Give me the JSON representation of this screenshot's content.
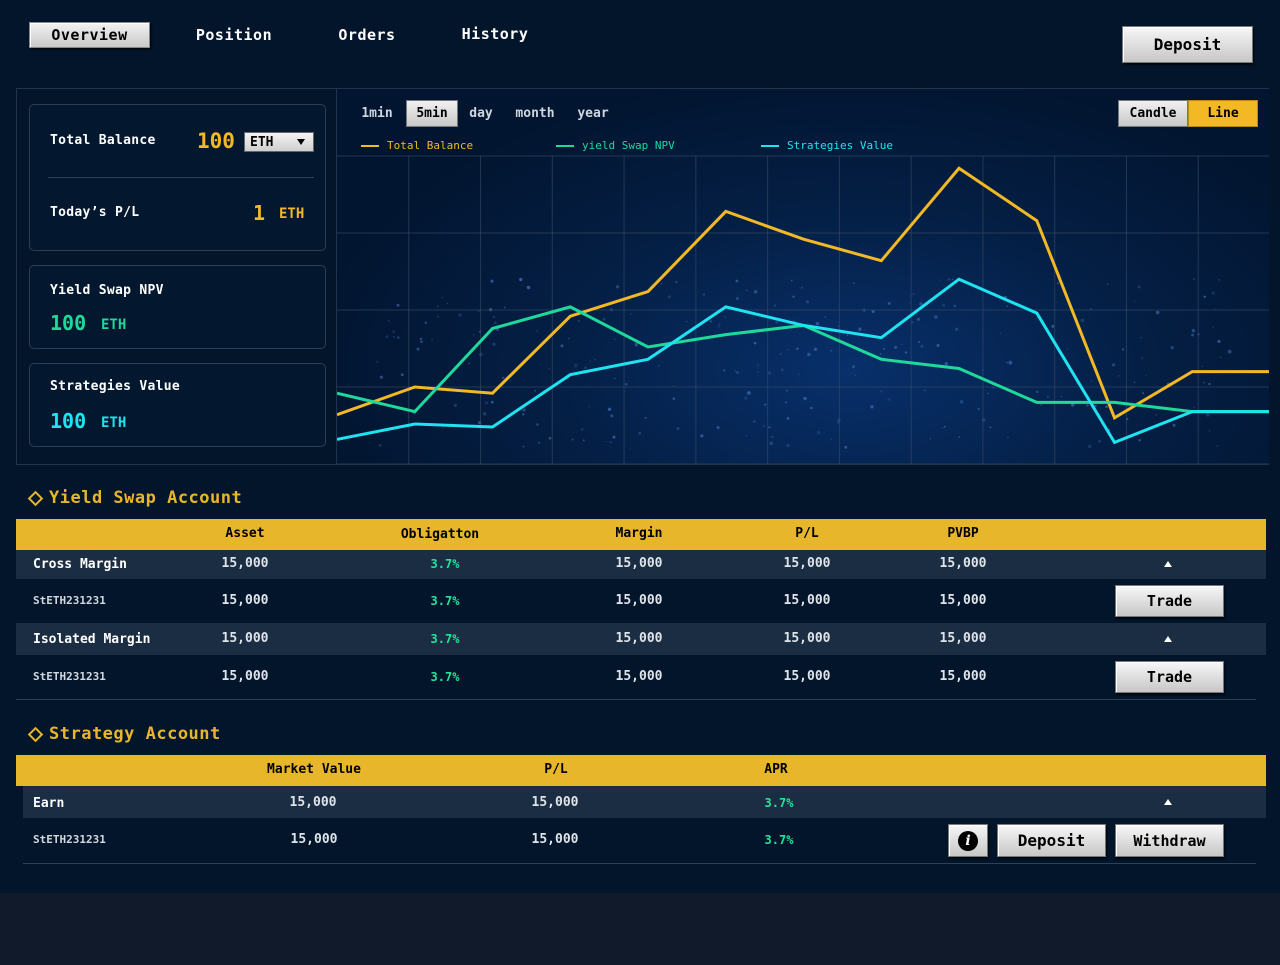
{
  "nav": {
    "tabs": [
      "Overview",
      "Position",
      "Orders",
      "History"
    ],
    "deposit_label": "Deposit"
  },
  "summary": {
    "total_balance_label": "Total Balance",
    "total_balance_value": "100",
    "currency_select": "ETH",
    "todays_pl_label": "Today’s P/L",
    "todays_pl_value": "1",
    "todays_pl_unit": "ETH",
    "yield_swap_label": "Yield Swap NPV",
    "yield_swap_value": "100",
    "yield_swap_unit": "ETH",
    "strategies_label": "Strategies Value",
    "strategies_value": "100",
    "strategies_unit": "ETH"
  },
  "chart_controls": {
    "timeframes": [
      "1min",
      "5min",
      "day",
      "month",
      "year"
    ],
    "active_timeframe": "5min",
    "views": [
      "Candle",
      "Line"
    ],
    "active_view": "Line"
  },
  "chart_data": {
    "type": "line",
    "grid": true,
    "legend_position": "top",
    "x": [
      0,
      1,
      2,
      3,
      4,
      5,
      6,
      7,
      8,
      9,
      10,
      11,
      12
    ],
    "ylim": [
      0,
      100
    ],
    "series": [
      {
        "name": "Total Balance",
        "color": "#f2b925",
        "values": [
          16,
          25,
          23,
          48,
          56,
          82,
          73,
          66,
          96,
          79,
          15,
          30,
          30
        ]
      },
      {
        "name": "yield Swap NPV",
        "color": "#1fd99a",
        "values": [
          23,
          17,
          44,
          51,
          38,
          42,
          45,
          34,
          31,
          20,
          20,
          17,
          17
        ]
      },
      {
        "name": "Strategies Value",
        "color": "#1fe3f0",
        "values": [
          8,
          13,
          12,
          29,
          34,
          51,
          45,
          41,
          60,
          49,
          7,
          17,
          17
        ]
      }
    ]
  },
  "yield_swap": {
    "title": "Yield Swap Account",
    "headers": [
      "Asset",
      "Obligatton",
      "Margin",
      "P/L",
      "PVBP"
    ],
    "rows": [
      {
        "label": "Cross Margin",
        "asset": "15,000",
        "obligation": "3.7%",
        "margin": "15,000",
        "pl": "15,000",
        "pvbp": "15,000"
      },
      {
        "label": "StETH231231",
        "asset": "15,000",
        "obligation": "3.7%",
        "margin": "15,000",
        "pl": "15,000",
        "pvbp": "15,000",
        "action": "Trade"
      },
      {
        "label": "Isolated Margin",
        "asset": "15,000",
        "obligation": "3.7%",
        "margin": "15,000",
        "pl": "15,000",
        "pvbp": "15,000"
      },
      {
        "label": "StETH231231",
        "asset": "15,000",
        "obligation": "3.7%",
        "margin": "15,000",
        "pl": "15,000",
        "pvbp": "15,000",
        "action": "Trade"
      }
    ]
  },
  "strategy": {
    "title": "Strategy Account",
    "headers": [
      "Market Value",
      "P/L",
      "APR"
    ],
    "rows": [
      {
        "label": "Earn",
        "market_value": "15,000",
        "pl": "15,000",
        "apr": "3.7%"
      },
      {
        "label": "StETH231231",
        "market_value": "15,000",
        "pl": "15,000",
        "apr": "3.7%",
        "info": "i",
        "deposit": "Deposit",
        "withdraw": "Withdraw"
      }
    ]
  }
}
